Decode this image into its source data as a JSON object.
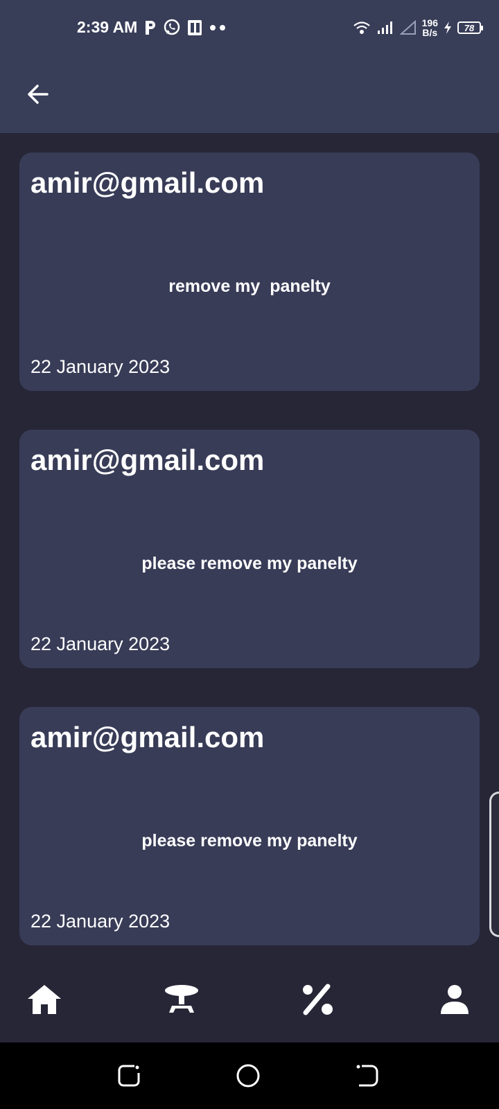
{
  "status_bar": {
    "time": "2:39 AM",
    "speed_value": "196",
    "speed_unit": "B/s",
    "battery": "78",
    "left_icons": [
      "parking-p-icon",
      "whatsapp-icon",
      "office-icon",
      "dots-icon"
    ],
    "right_icons": [
      "wifi-icon",
      "signal-icon",
      "signal-empty-icon",
      "charging-icon"
    ]
  },
  "app_bar": {
    "back_icon": "arrow-left-icon"
  },
  "complaints": [
    {
      "email": "amir@gmail.com",
      "message": "remove my  panelty",
      "date": "22 January 2023"
    },
    {
      "email": "amir@gmail.com",
      "message": "please remove my panelty",
      "date": "22 January 2023"
    },
    {
      "email": "amir@gmail.com",
      "message": "please remove my panelty",
      "date": "22 January 2023"
    }
  ],
  "bottom_nav": [
    "home-icon",
    "table-icon",
    "percent-icon",
    "person-icon"
  ],
  "system_nav": [
    "recent-apps-icon",
    "home-circle-icon",
    "back-icon"
  ],
  "colors": {
    "header_bg": "#383d58",
    "page_bg": "#272637",
    "card_bg": "#383c57",
    "text": "#ffffff"
  }
}
